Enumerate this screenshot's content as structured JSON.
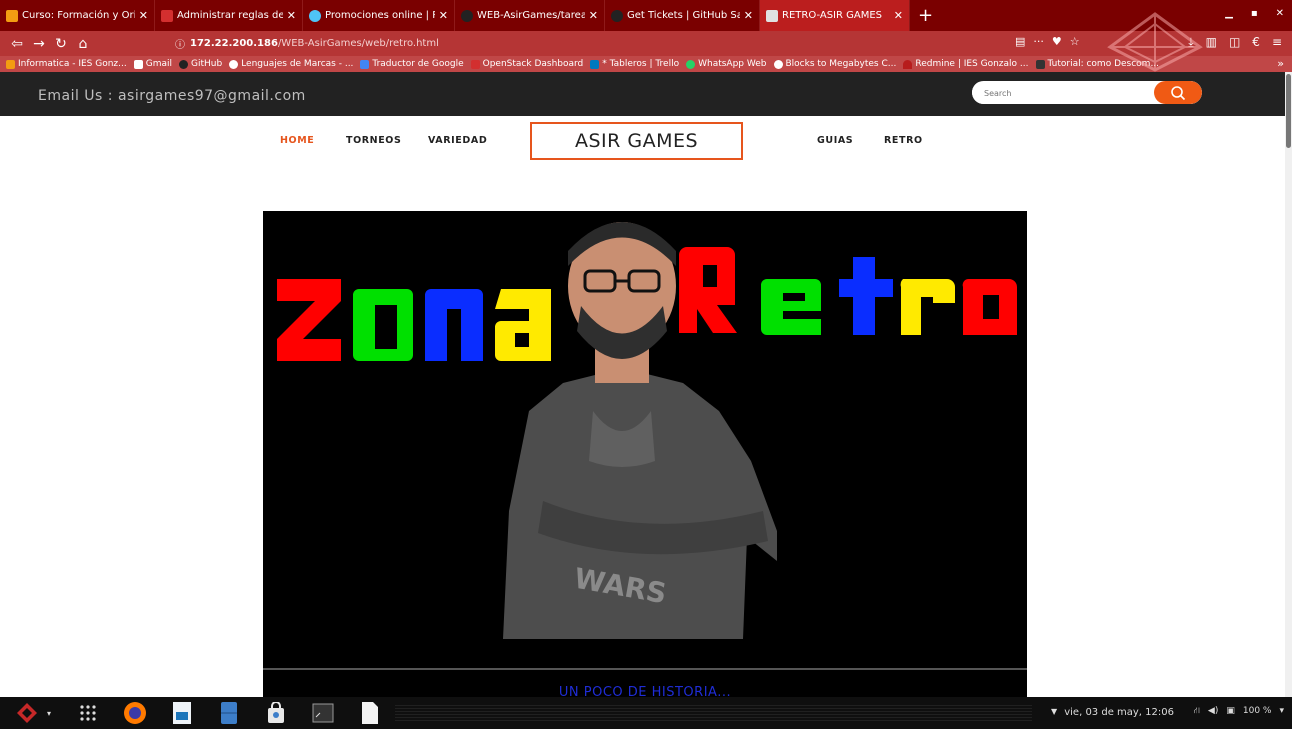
{
  "browser": {
    "tabs": [
      {
        "label": "Curso: Formación y Orien",
        "icon_color": "#f39c12",
        "active": false
      },
      {
        "label": "Administrar reglas de gru",
        "icon_color": "#d32f2f",
        "active": false
      },
      {
        "label": "Promociones online | Pla",
        "icon_color": "#4fc3f7",
        "active": false
      },
      {
        "label": "WEB-AsirGames/tarea f",
        "icon_color": "#222222",
        "active": false
      },
      {
        "label": "Get Tickets | GitHub Sate",
        "icon_color": "#222222",
        "active": false
      },
      {
        "label": "RETRO-ASIR GAMES",
        "icon_color": "#e0e0e0",
        "active": true
      }
    ],
    "new_tab_label": "+",
    "url_host": "172.22.200.186",
    "url_path": "/WEB-AsirGames/web/retro.html",
    "bookmarks": [
      {
        "label": "Informatica - IES Gonz...",
        "icon_color": "#f39c12"
      },
      {
        "label": "Gmail",
        "icon_color": "#ffffff"
      },
      {
        "label": "GitHub",
        "icon_color": "#222222"
      },
      {
        "label": "Lenguajes de Marcas - ...",
        "icon_color": "#ffffff"
      },
      {
        "label": "Traductor de Google",
        "icon_color": "#4285f4"
      },
      {
        "label": "OpenStack Dashboard",
        "icon_color": "#d32f2f"
      },
      {
        "label": "* Tableros | Trello",
        "icon_color": "#0079bf"
      },
      {
        "label": "WhatsApp Web",
        "icon_color": "#25d366"
      },
      {
        "label": "Blocks to Megabytes C...",
        "icon_color": "#ffffff"
      },
      {
        "label": "Redmine | IES Gonzalo ...",
        "icon_color": "#b71c1c"
      },
      {
        "label": "Tutorial: como Descom...",
        "icon_color": "#333333"
      }
    ],
    "bookmarks_more": "»"
  },
  "site": {
    "email_text": "Email Us : asirgames97@gmail.com",
    "search_placeholder": "Search",
    "nav": {
      "home": "HOME",
      "torneos": "TORNEOS",
      "variedad": "VARIEDAD",
      "logo": "ASIR GAMES",
      "guias": "GUIAS",
      "retro": "RETRO"
    },
    "hero": {
      "word1": "Zona",
      "word2": "Retro",
      "subtitle": "UN POCO DE HISTORIA..."
    },
    "accent_color": "#e6551d"
  },
  "taskbar": {
    "clock": "vie, 03 de may, 12:06",
    "volume_label": "100 %"
  }
}
